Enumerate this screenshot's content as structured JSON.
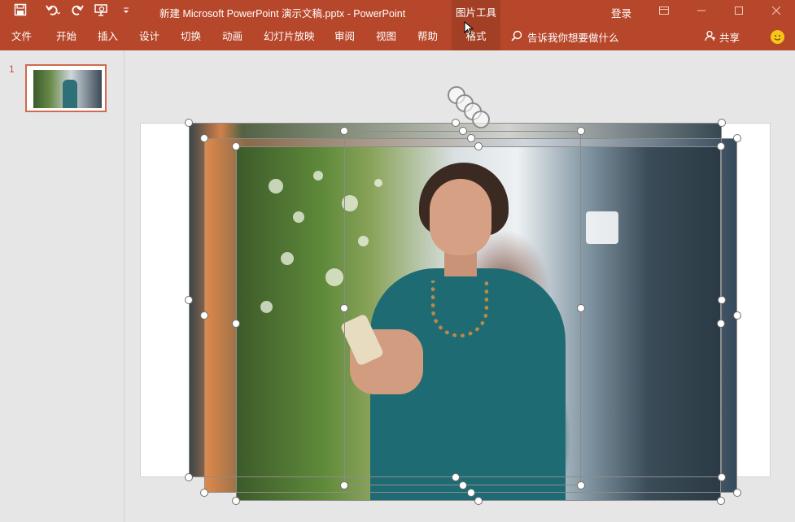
{
  "window": {
    "title": "新建 Microsoft PowerPoint 演示文稿.pptx  -  PowerPoint",
    "context_label": "图片工具",
    "login": "登录"
  },
  "qat": {
    "save_icon": "save-icon",
    "undo_icon": "undo-icon",
    "redo_icon": "redo-icon",
    "present_icon": "present-from-start-icon",
    "customize_icon": "customize-qat-icon"
  },
  "ribbon": {
    "tabs": [
      "文件",
      "开始",
      "插入",
      "设计",
      "切换",
      "动画",
      "幻灯片放映",
      "审阅",
      "视图",
      "帮助",
      "格式"
    ],
    "active_tab": "格式",
    "tell_me": "告诉我你想要做什么",
    "share": "共享"
  },
  "thumbnails": [
    {
      "number": "1"
    }
  ],
  "colors": {
    "brand": "#b7472a",
    "context_tab": "#a33f25",
    "thumb_border": "#d06a4c"
  }
}
